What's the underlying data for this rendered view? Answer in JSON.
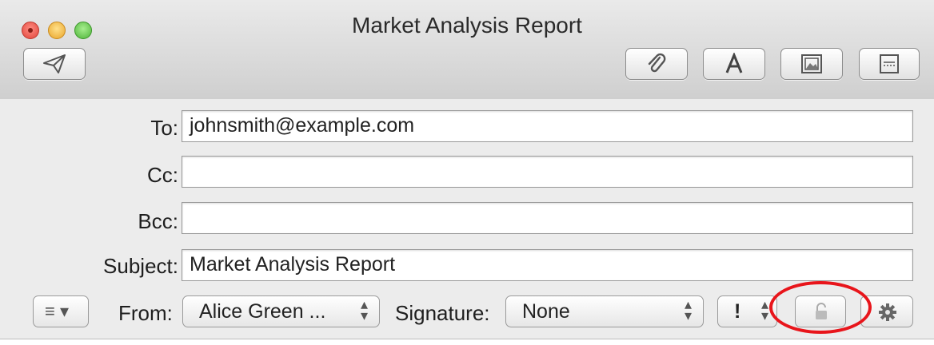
{
  "window": {
    "title": "Market Analysis Report"
  },
  "toolbar": {
    "send": "send-icon",
    "attach": "paperclip-icon",
    "fonts": "fonts-icon",
    "photo": "photo-browser-icon",
    "template": "stationery-icon"
  },
  "fields": {
    "to": {
      "label": "To:",
      "value": "johnsmith@example.com"
    },
    "cc": {
      "label": "Cc:",
      "value": ""
    },
    "bcc": {
      "label": "Bcc:",
      "value": ""
    },
    "subject": {
      "label": "Subject:",
      "value": "Market Analysis Report"
    }
  },
  "options": {
    "header_menu_glyph": "≡ ▾",
    "from_label": "From:",
    "from_value": "Alice Green ...",
    "signature_label": "Signature:",
    "signature_value": "None",
    "priority_value": "!",
    "lock": "lock-icon",
    "settings": "gear-icon"
  },
  "colors": {
    "highlight": "#e8151b"
  }
}
